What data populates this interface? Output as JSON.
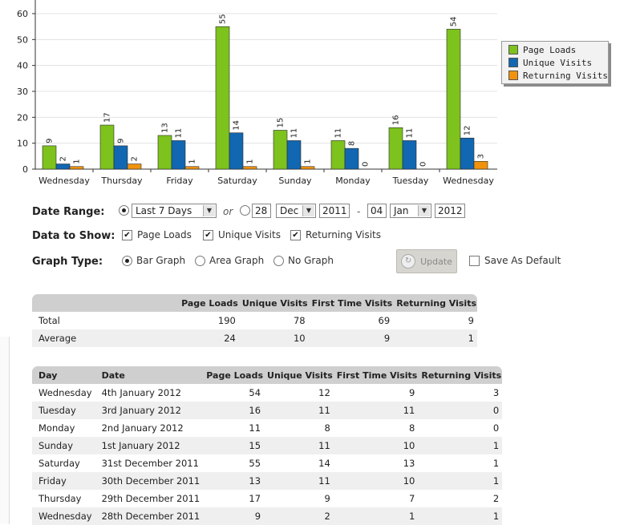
{
  "colors": {
    "page_loads": "#7dc21d",
    "unique_visits": "#1167b1",
    "returning_visits": "#f0920e",
    "header_bg": "#cfcfcf"
  },
  "chart_data": {
    "type": "bar",
    "categories": [
      "Wednesday",
      "Thursday",
      "Friday",
      "Saturday",
      "Sunday",
      "Monday",
      "Tuesday",
      "Wednesday"
    ],
    "series": [
      {
        "name": "Page Loads",
        "values": [
          9,
          17,
          13,
          55,
          15,
          11,
          16,
          54
        ]
      },
      {
        "name": "Unique Visits",
        "values": [
          2,
          9,
          11,
          14,
          11,
          8,
          11,
          12
        ]
      },
      {
        "name": "Returning Visits",
        "values": [
          1,
          2,
          1,
          1,
          1,
          0,
          0,
          3
        ]
      }
    ],
    "yticks": [
      0,
      10,
      20,
      30,
      40,
      50,
      60
    ],
    "ylim": [
      0,
      60
    ],
    "grid": true,
    "legend_position": "right"
  },
  "form": {
    "date_range": {
      "label": "Date Range:",
      "preset": "Last 7 Days",
      "or_text": "or",
      "from_day": "28",
      "from_month": "Dec",
      "from_year": "2011",
      "dash": "-",
      "to_day": "04",
      "to_month": "Jan",
      "to_year": "2012"
    },
    "data_to_show": {
      "label": "Data to Show:",
      "options": [
        "Page Loads",
        "Unique Visits",
        "Returning Visits"
      ]
    },
    "graph_type": {
      "label": "Graph Type:",
      "options": [
        "Bar Graph",
        "Area Graph",
        "No Graph"
      ],
      "selected": "Bar Graph"
    },
    "update_label": "Update",
    "save_default_label": "Save As Default"
  },
  "summary_table": {
    "headers": [
      "",
      "Page Loads",
      "Unique Visits",
      "First Time Visits",
      "Returning Visits"
    ],
    "rows": [
      [
        "Total",
        "190",
        "78",
        "69",
        "9"
      ],
      [
        "Average",
        "24",
        "10",
        "9",
        "1"
      ]
    ]
  },
  "daily_table": {
    "headers": [
      "Day",
      "Date",
      "Page Loads",
      "Unique Visits",
      "First Time Visits",
      "Returning Visits"
    ],
    "rows": [
      [
        "Wednesday",
        "4th January 2012",
        "54",
        "12",
        "9",
        "3"
      ],
      [
        "Tuesday",
        "3rd January 2012",
        "16",
        "11",
        "11",
        "0"
      ],
      [
        "Monday",
        "2nd January 2012",
        "11",
        "8",
        "8",
        "0"
      ],
      [
        "Sunday",
        "1st January 2012",
        "15",
        "11",
        "10",
        "1"
      ],
      [
        "Saturday",
        "31st December 2011",
        "55",
        "14",
        "13",
        "1"
      ],
      [
        "Friday",
        "30th December 2011",
        "13",
        "11",
        "10",
        "1"
      ],
      [
        "Thursday",
        "29th December 2011",
        "17",
        "9",
        "7",
        "2"
      ],
      [
        "Wednesday",
        "28th December 2011",
        "9",
        "2",
        "1",
        "1"
      ]
    ]
  }
}
